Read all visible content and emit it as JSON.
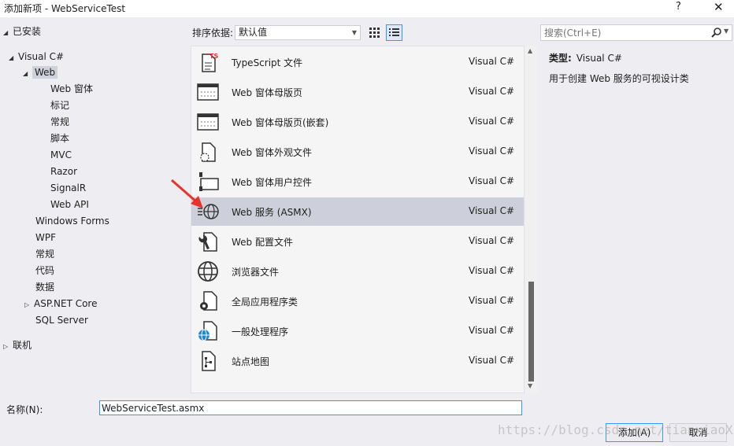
{
  "window": {
    "title": "添加新项 - WebServiceTest",
    "help": "?",
    "close": "✕"
  },
  "tree": {
    "installed": "已安装",
    "visual_csharp": "Visual C#",
    "web": "Web",
    "web_children": [
      "Web 窗体",
      "标记",
      "常规",
      "脚本",
      "MVC",
      "Razor",
      "SignalR",
      "Web API"
    ],
    "other": [
      "Windows Forms",
      "WPF",
      "常规",
      "代码",
      "数据"
    ],
    "aspnet_core": "ASP.NET Core",
    "sql_server": "SQL Server",
    "online": "联机"
  },
  "toolbar": {
    "sort_label": "排序依据:",
    "sort_value": "默认值"
  },
  "items": [
    {
      "name": "TypeScript 文件",
      "lang": "Visual C#",
      "icon": "typescript-file-icon"
    },
    {
      "name": "Web 窗体母版页",
      "lang": "Visual C#",
      "icon": "master-page-icon"
    },
    {
      "name": "Web 窗体母版页(嵌套)",
      "lang": "Visual C#",
      "icon": "nested-master-page-icon"
    },
    {
      "name": "Web 窗体外观文件",
      "lang": "Visual C#",
      "icon": "skin-file-icon"
    },
    {
      "name": "Web 窗体用户控件",
      "lang": "Visual C#",
      "icon": "user-control-icon"
    },
    {
      "name": "Web 服务 (ASMX)",
      "lang": "Visual C#",
      "icon": "web-service-icon",
      "selected": true
    },
    {
      "name": "Web 配置文件",
      "lang": "Visual C#",
      "icon": "web-config-icon"
    },
    {
      "name": "浏览器文件",
      "lang": "Visual C#",
      "icon": "browser-file-icon"
    },
    {
      "name": "全局应用程序类",
      "lang": "Visual C#",
      "icon": "global-app-class-icon"
    },
    {
      "name": "一般处理程序",
      "lang": "Visual C#",
      "icon": "generic-handler-icon"
    },
    {
      "name": "站点地图",
      "lang": "Visual C#",
      "icon": "sitemap-icon"
    }
  ],
  "search": {
    "placeholder": "搜索(Ctrl+E)"
  },
  "details": {
    "type_label": "类型:",
    "type_value": "Visual C#",
    "description": "用于创建 Web 服务的可视设计类"
  },
  "bottom": {
    "name_label": "名称(N):",
    "name_value": "WebServiceTest.asmx",
    "add_button": "添加(A)",
    "cancel_button": "取消"
  },
  "watermark": "https://blog.csdn.net/tianxiaoXiaZ",
  "colors": {
    "accent": "#3399ff",
    "selection": "#cdd0da",
    "arrow": "#e8322a"
  }
}
